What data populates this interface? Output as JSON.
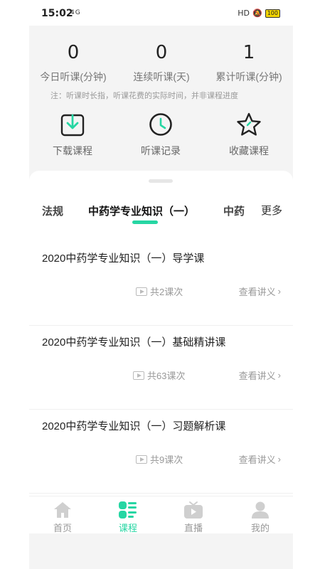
{
  "status": {
    "time": "15:02",
    "signal": "4G",
    "hd": "HD",
    "battery": "100"
  },
  "stats": [
    {
      "value": "0",
      "label": "今日听课(分钟)"
    },
    {
      "value": "0",
      "label": "连续听课(天)"
    },
    {
      "value": "1",
      "label": "累计听课(分钟)"
    }
  ],
  "note": "注：听课时长指，听课花费的实际时间，并非课程进度",
  "actions": [
    {
      "label": "下载课程",
      "icon": "download-icon"
    },
    {
      "label": "听课记录",
      "icon": "clock-icon"
    },
    {
      "label": "收藏课程",
      "icon": "star-icon"
    }
  ],
  "tabs": {
    "left": "法规",
    "active": "中药学专业知识（一）",
    "right": "中药",
    "more": "更多"
  },
  "courses": [
    {
      "title": "2020中药学专业知识（一）导学课",
      "count": "共2课次",
      "action": "查看讲义"
    },
    {
      "title": "2020中药学专业知识（一）基础精讲课",
      "count": "共63课次",
      "action": "查看讲义"
    },
    {
      "title": "2020中药学专业知识（一）习题解析课",
      "count": "共9课次",
      "action": "查看讲义"
    }
  ],
  "nav": [
    {
      "label": "首页",
      "icon": "home-icon"
    },
    {
      "label": "课程",
      "icon": "course-icon",
      "active": true
    },
    {
      "label": "直播",
      "icon": "live-tv-icon"
    },
    {
      "label": "我的",
      "icon": "profile-icon"
    }
  ],
  "colors": {
    "accent": "#26d6a3",
    "icon_stroke": "#222222",
    "nav_inactive": "#cfcfcf"
  }
}
